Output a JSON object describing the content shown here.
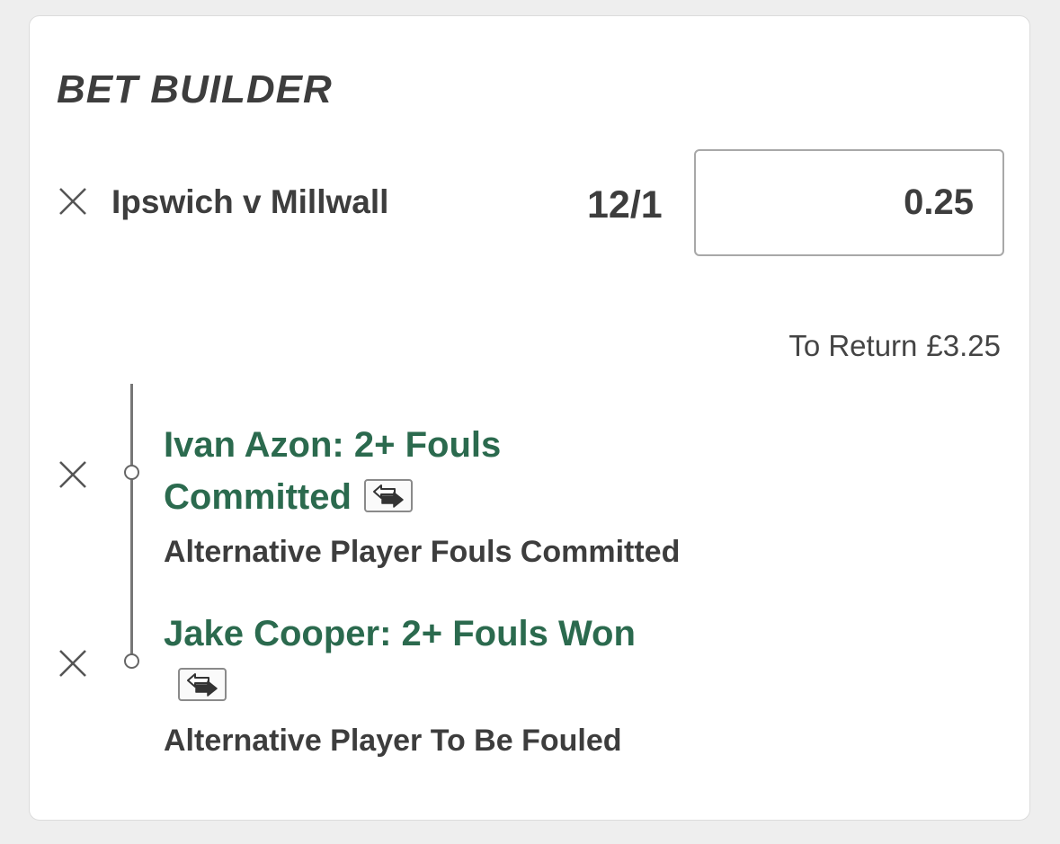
{
  "bet_builder": {
    "title": "BET BUILDER",
    "match": "Ipswich v Millwall",
    "odds": "12/1",
    "stake": "0.25",
    "to_return_label": "To Return",
    "to_return_value": "£3.25",
    "legs": [
      {
        "selection": "Ivan Azon: 2+ Fouls Committed",
        "market": "Alternative Player Fouls Committed"
      },
      {
        "selection": "Jake Cooper: 2+ Fouls Won",
        "market": "Alternative Player To Be Fouled"
      }
    ]
  },
  "icons": {
    "remove": "close-icon",
    "swap": "swap-arrows-icon"
  },
  "colors": {
    "selection_green": "#2b6a4e",
    "text_dark": "#3d3d3d",
    "background": "#eeeeee",
    "card": "#ffffff"
  }
}
